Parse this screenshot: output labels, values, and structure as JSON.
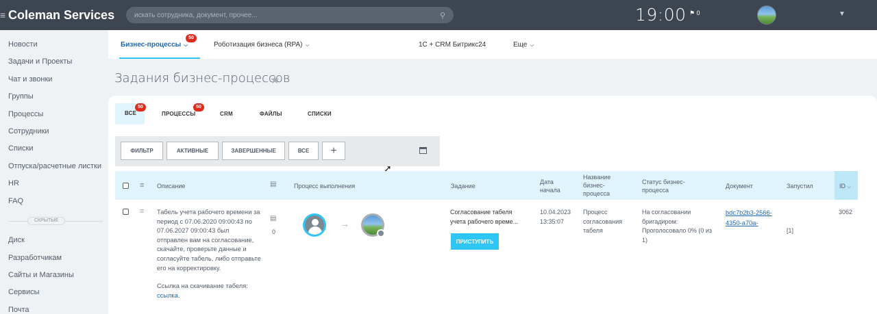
{
  "topbar": {
    "brand": "Coleman Services",
    "search_placeholder": "искать сотрудника, документ, прочее...",
    "time": "19:00",
    "flag_count": "0"
  },
  "sidebar": {
    "items": [
      "Новости",
      "Задачи и Проекты",
      "Чат и звонки",
      "Группы",
      "Процессы",
      "Сотрудники",
      "Списки",
      "Отпуска/расчетные листки",
      "HR",
      "FAQ"
    ],
    "hidden_label": "СКРЫТЫЕ",
    "items_bottom": [
      "Диск",
      "Разработчикам",
      "Сайты и Магазины",
      "Сервисы",
      "Почта"
    ]
  },
  "nav": {
    "tabs": [
      {
        "label": "Бизнес-процессы",
        "badge": "50"
      },
      {
        "label": "Роботизация бизнеса (RPA)"
      },
      {
        "label": "1С + CRM Битрикс24"
      },
      {
        "label": "Еще"
      }
    ]
  },
  "page": {
    "title": "Задания бизнес-процессов"
  },
  "filter_tabs": [
    {
      "label": "ВСЕ",
      "badge": "50"
    },
    {
      "label": "ПРОЦЕССЫ",
      "badge": "50"
    },
    {
      "label": "CRM"
    },
    {
      "label": "ФАЙЛЫ"
    },
    {
      "label": "СПИСКИ"
    }
  ],
  "toolbar": {
    "filter": "ФИЛЬТР",
    "active": "АКТИВНЫЕ",
    "finished": "ЗАВЕРШЕННЫЕ",
    "all": "ВСЕ",
    "add": "+"
  },
  "table": {
    "headers": {
      "description": "Описание",
      "process": "Процесс выполнения",
      "task": "Задание",
      "start_date": [
        "Дата",
        "начала"
      ],
      "bp_name": [
        "Название",
        "бизнес-",
        "процесса"
      ],
      "bp_status": [
        "Статус бизнес-",
        "процесса"
      ],
      "document": "Документ",
      "started_by": "Запустил",
      "id": "ID"
    },
    "row": {
      "description": "Табель учета рабочего времени за период с 07.06.2020 09:00:43 по 07.06.2027 09:00:43 был отправлен вам на согласование, скачайте, проверьте данные и согласуйте табель, либо отправьте его на корректировку.",
      "download_text": "Ссылка на скачивание табеля:",
      "download_link": "ссылка.",
      "comments": "0",
      "task_title": "Согласование табеля учета рабочего време...",
      "go_button": "ПРИСТУПИТЬ",
      "start_date": "10.04.2023",
      "start_time": "13:35:07",
      "bp_name": "Процесс согласования табеля",
      "bp_status": "На согласовании бригадиром: Проголосовало 0% (0 из 1)",
      "document": "bdc7b2b3-2566-4350-a70a-",
      "started_by": "[1]",
      "id": "3062"
    }
  }
}
